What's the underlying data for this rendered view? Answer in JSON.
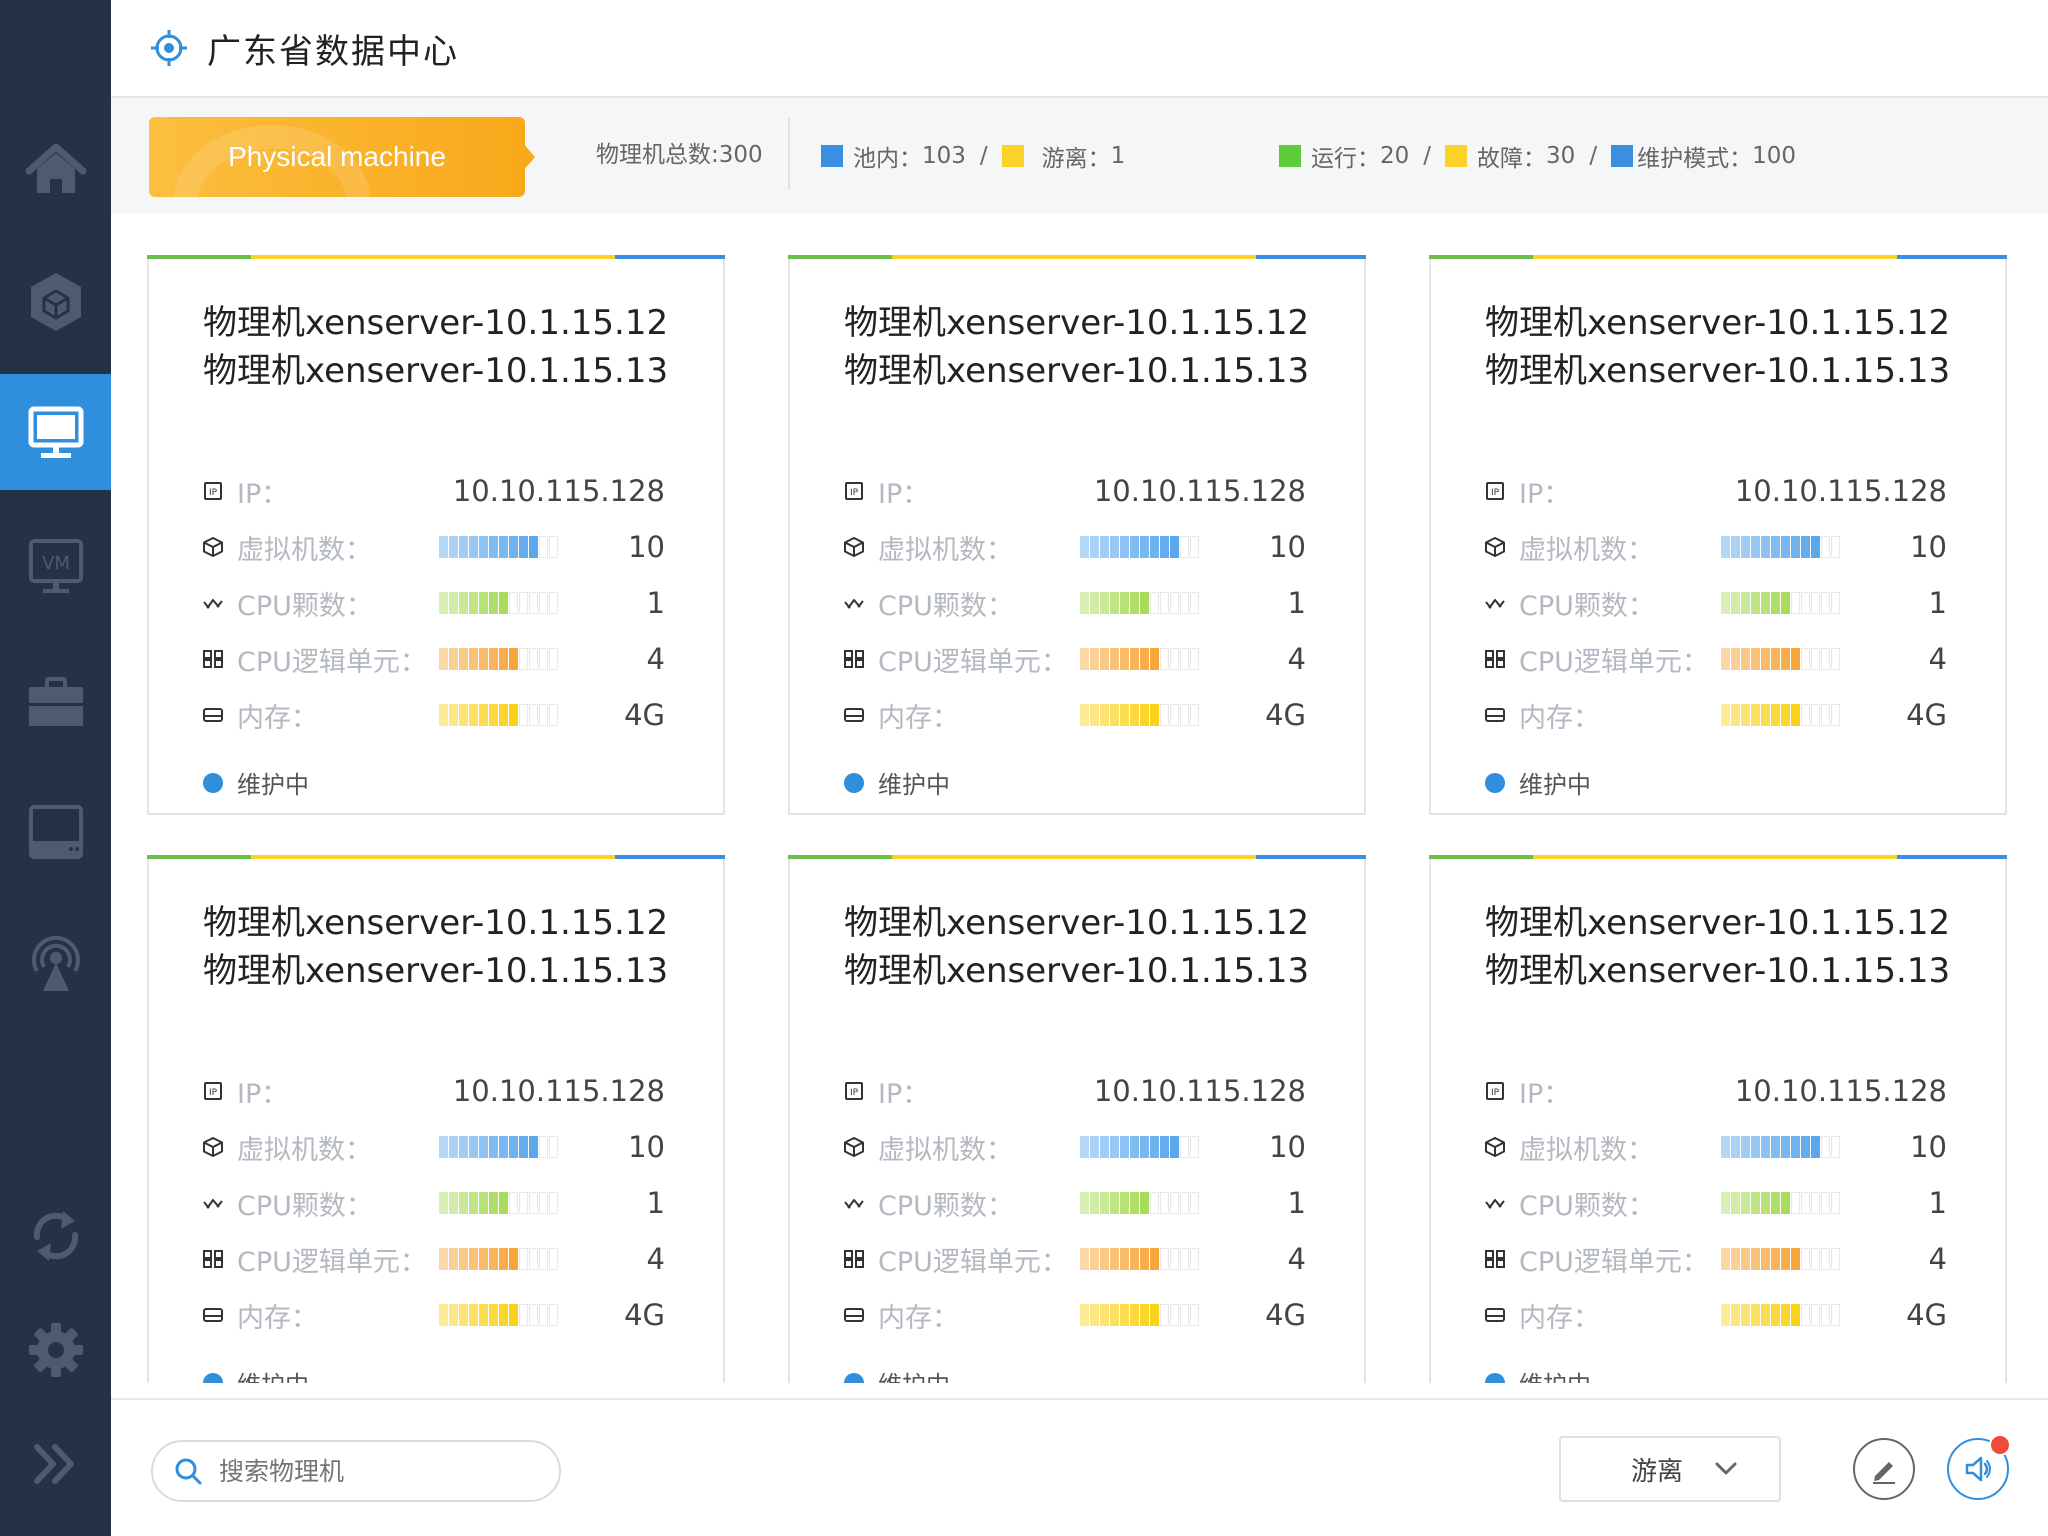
{
  "header": {
    "title": "广东省数据中心",
    "icon": "target-icon"
  },
  "sidebar": {
    "items": [
      {
        "name": "home",
        "icon": "home-icon"
      },
      {
        "name": "cube",
        "icon": "cube-icon"
      },
      {
        "name": "monitor",
        "icon": "monitor-icon",
        "active": true
      },
      {
        "name": "vm",
        "icon": "vm-icon",
        "text": "VM"
      },
      {
        "name": "briefcase",
        "icon": "briefcase-icon"
      },
      {
        "name": "drive",
        "icon": "drive-icon"
      },
      {
        "name": "broadcast",
        "icon": "broadcast-icon"
      },
      {
        "name": "refresh",
        "icon": "refresh-icon"
      },
      {
        "name": "settings",
        "icon": "gear-icon"
      },
      {
        "name": "expand",
        "icon": "double-chevron-icon"
      }
    ]
  },
  "stats": {
    "tag_label": "Physical machine",
    "total": "物理机总数:300",
    "pool": {
      "label": "池内：",
      "value": "103",
      "sep": "/",
      "color": "#3b8fe0"
    },
    "orphan": {
      "label": "游离：",
      "value": "1",
      "color": "#fcd12a"
    },
    "running": {
      "label": "运行：",
      "value": "20",
      "sep": "/",
      "color": "#5ccc3a"
    },
    "fault": {
      "label": "故障：",
      "value": "30",
      "sep": "/",
      "color": "#fcd12a"
    },
    "maintenance": {
      "label": "维护模式：",
      "value": "100",
      "color": "#3b8fe0"
    }
  },
  "card_template": {
    "title_line1": "物理机xenserver-10.1.15.12",
    "title_line2": "物理机xenserver-10.1.15.13",
    "ip_label": "IP：",
    "ip_value": "10.10.115.128",
    "vm_label": "虚拟机数：",
    "vm_value": "10",
    "cpu_label": "CPU颗数：",
    "cpu_value": "1",
    "cpu_logic_label": "CPU逻辑单元：",
    "cpu_logic_value": "4",
    "mem_label": "内存：",
    "mem_value": "4G",
    "status": "维护中"
  },
  "cards": [
    {
      "title_line1": "物理机xenserver-10.1.15.12",
      "title_line2": "物理机xenserver-10.1.15.13",
      "ip_label": "IP：",
      "ip_value": "10.10.115.128",
      "vm_label": "虚拟机数：",
      "vm_value": "10",
      "vm_level": 0.8,
      "cpu_label": "CPU颗数：",
      "cpu_value": "1",
      "cpu_level": 0.6,
      "cpu_logic_label": "CPU逻辑单元：",
      "cpu_logic_value": "4",
      "cpu_logic_level": 0.7,
      "mem_label": "内存：",
      "mem_value": "4G",
      "mem_level": 0.7,
      "status": "维护中"
    },
    {
      "title_line1": "物理机xenserver-10.1.15.12",
      "title_line2": "物理机xenserver-10.1.15.13",
      "ip_label": "IP：",
      "ip_value": "10.10.115.128",
      "vm_label": "虚拟机数：",
      "vm_value": "10",
      "vm_level": 0.8,
      "cpu_label": "CPU颗数：",
      "cpu_value": "1",
      "cpu_level": 0.6,
      "cpu_logic_label": "CPU逻辑单元：",
      "cpu_logic_value": "4",
      "cpu_logic_level": 0.7,
      "mem_label": "内存：",
      "mem_value": "4G",
      "mem_level": 0.7,
      "status": "维护中"
    },
    {
      "title_line1": "物理机xenserver-10.1.15.12",
      "title_line2": "物理机xenserver-10.1.15.13",
      "ip_label": "IP：",
      "ip_value": "10.10.115.128",
      "vm_label": "虚拟机数：",
      "vm_value": "10",
      "vm_level": 0.8,
      "cpu_label": "CPU颗数：",
      "cpu_value": "1",
      "cpu_level": 0.6,
      "cpu_logic_label": "CPU逻辑单元：",
      "cpu_logic_value": "4",
      "cpu_logic_level": 0.7,
      "mem_label": "内存：",
      "mem_value": "4G",
      "mem_level": 0.7,
      "status": "维护中"
    },
    {
      "title_line1": "物理机xenserver-10.1.15.12",
      "title_line2": "物理机xenserver-10.1.15.13",
      "ip_label": "IP：",
      "ip_value": "10.10.115.128",
      "vm_label": "虚拟机数：",
      "vm_value": "10",
      "vm_level": 0.8,
      "cpu_label": "CPU颗数：",
      "cpu_value": "1",
      "cpu_level": 0.6,
      "cpu_logic_label": "CPU逻辑单元：",
      "cpu_logic_value": "4",
      "cpu_logic_level": 0.7,
      "mem_label": "内存：",
      "mem_value": "4G",
      "mem_level": 0.7,
      "status": "维护中"
    },
    {
      "title_line1": "物理机xenserver-10.1.15.12",
      "title_line2": "物理机xenserver-10.1.15.13",
      "ip_label": "IP：",
      "ip_value": "10.10.115.128",
      "vm_label": "虚拟机数：",
      "vm_value": "10",
      "vm_level": 0.8,
      "cpu_label": "CPU颗数：",
      "cpu_value": "1",
      "cpu_level": 0.6,
      "cpu_logic_label": "CPU逻辑单元：",
      "cpu_logic_value": "4",
      "cpu_logic_level": 0.7,
      "mem_label": "内存：",
      "mem_value": "4G",
      "mem_level": 0.7,
      "status": "维护中"
    },
    {
      "title_line1": "物理机xenserver-10.1.15.12",
      "title_line2": "物理机xenserver-10.1.15.13",
      "ip_label": "IP：",
      "ip_value": "10.10.115.128",
      "vm_label": "虚拟机数：",
      "vm_value": "10",
      "vm_level": 0.8,
      "cpu_label": "CPU颗数：",
      "cpu_value": "1",
      "cpu_level": 0.6,
      "cpu_logic_label": "CPU逻辑单元：",
      "cpu_logic_value": "4",
      "cpu_logic_level": 0.7,
      "mem_label": "内存：",
      "mem_value": "4G",
      "mem_level": 0.7,
      "status": "维护中"
    }
  ],
  "bar_colors": {
    "vm": "#5aa7ec",
    "cpu": "#a8dc5a",
    "cpu_logic": "#f6a63b",
    "mem": "#fad21a",
    "status_dot": "#2f8fdc"
  },
  "bottom": {
    "search_placeholder": "搜索物理机",
    "select_value": "游离",
    "edit_icon": "pencil-icon",
    "speaker_icon": "speaker-icon"
  }
}
